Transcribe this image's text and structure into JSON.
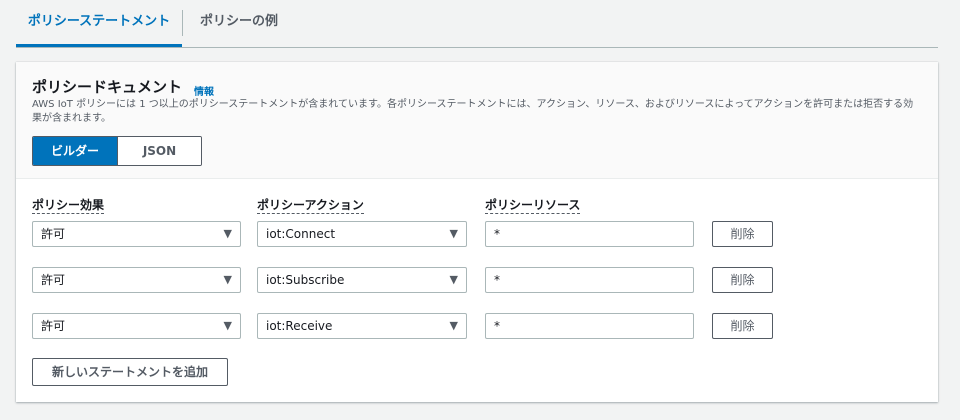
{
  "tabs": [
    {
      "label": "ポリシーステートメント",
      "active": true
    },
    {
      "label": "ポリシーの例",
      "active": false
    }
  ],
  "card": {
    "title": "ポリシードキュメント",
    "info_link": "情報",
    "description": "AWS IoT ポリシーには 1 つ以上のポリシーステートメントが含まれています。各ポリシーステートメントには、アクション、リソース、およびリソースによってアクションを許可または拒否する効果が含まれます。",
    "mode_toggle": {
      "builder_label": "ビルダー",
      "json_label": "JSON",
      "selected": "ビルダー"
    }
  },
  "columns": {
    "effect": "ポリシー効果",
    "action": "ポリシーアクション",
    "resource": "ポリシーリソース"
  },
  "statements": [
    {
      "effect": "許可",
      "action": "iot:Connect",
      "resource": "*",
      "delete_label": "削除"
    },
    {
      "effect": "許可",
      "action": "iot:Subscribe",
      "resource": "*",
      "delete_label": "削除"
    },
    {
      "effect": "許可",
      "action": "iot:Receive",
      "resource": "*",
      "delete_label": "削除"
    }
  ],
  "add_statement_label": "新しいステートメントを追加",
  "colors": {
    "accent": "#0073bb",
    "text": "#16191f",
    "muted": "#545b64",
    "border": "#aab7b8",
    "page_bg": "#f2f3f3"
  },
  "icons": {
    "dropdown": "caret-down-icon"
  }
}
